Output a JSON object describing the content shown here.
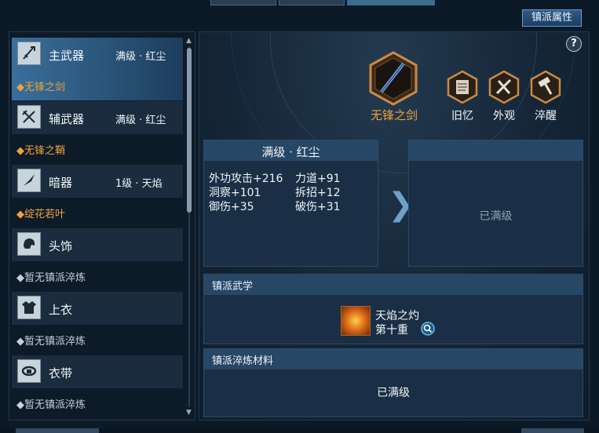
{
  "header": {
    "sect_attr_button": "镇派属性"
  },
  "slots": [
    {
      "name": "主武器",
      "level": "满级 · 红尘",
      "sub": "◆无锋之剑",
      "sub_style": "orange",
      "icon": "sword-icon",
      "selected": true
    },
    {
      "name": "辅武器",
      "level": "满级 · 红尘",
      "sub": "◆无锋之鞘",
      "sub_style": "orange",
      "icon": "crossed-blades-icon",
      "selected": false
    },
    {
      "name": "暗器",
      "level": "1级 · 天焰",
      "sub": "◆绽花若叶",
      "sub_style": "orange",
      "icon": "dart-icon",
      "selected": false
    },
    {
      "name": "头饰",
      "level": "",
      "sub": "◆暂无镇派淬炼",
      "sub_style": "gray",
      "icon": "helmet-icon",
      "selected": false
    },
    {
      "name": "上衣",
      "level": "",
      "sub": "◆暂无镇派淬炼",
      "sub_style": "gray",
      "icon": "armor-icon",
      "selected": false
    },
    {
      "name": "衣带",
      "level": "",
      "sub": "◆暂无镇派淬炼",
      "sub_style": "gray",
      "icon": "belt-icon",
      "selected": false
    }
  ],
  "weapon": {
    "name": "无锋之剑"
  },
  "actions": [
    {
      "label": "旧忆",
      "icon": "scroll-icon"
    },
    {
      "label": "外观",
      "icon": "appearance-icon"
    },
    {
      "label": "淬醒",
      "icon": "hammer-icon"
    }
  ],
  "current_stats": {
    "title": "满级 · 红尘",
    "items": [
      "外功攻击+216",
      "力道+91",
      "洞察+101",
      "拆招+12",
      "御伤+35",
      "破伤+31"
    ]
  },
  "next_stats": {
    "text": "已满级"
  },
  "martial": {
    "title": "镇派武学",
    "skill_name": "天焰之灼",
    "skill_rank": "第十重"
  },
  "materials": {
    "title": "镇派淬炼材料",
    "text": "已满级"
  },
  "colors": {
    "accent_orange": "#f0a23c",
    "selected_blue": "#3a6f9c",
    "panel_bg": "#1a2f45"
  }
}
